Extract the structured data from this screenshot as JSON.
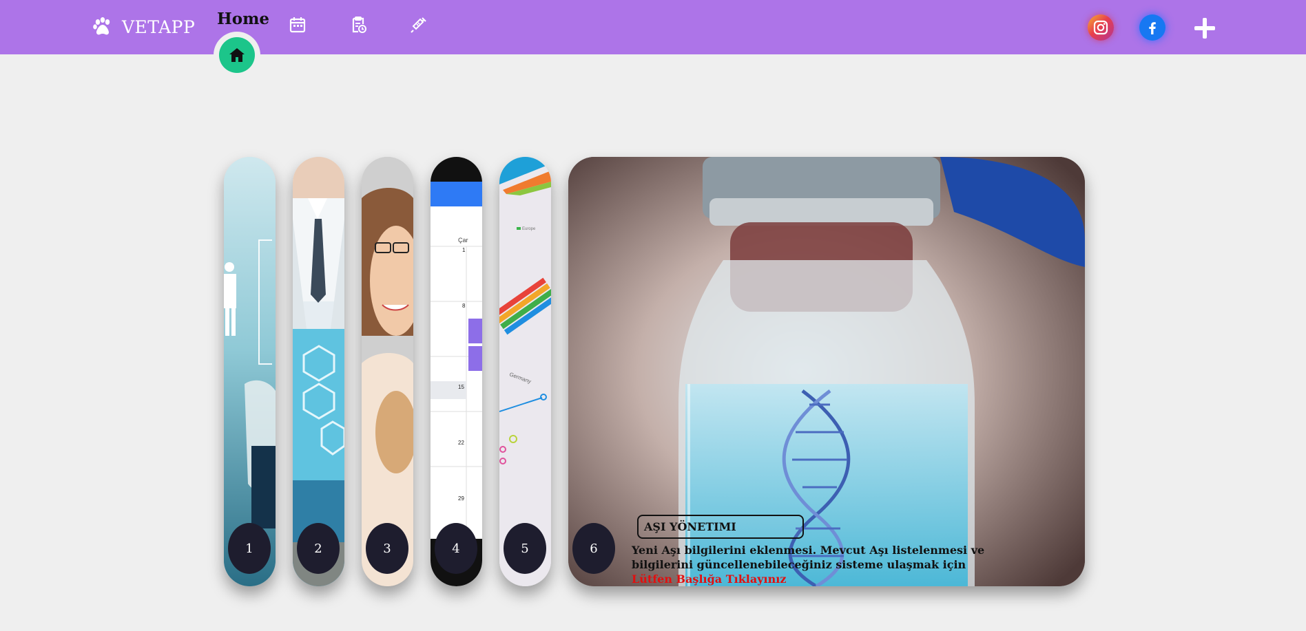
{
  "brand": {
    "name": "VETAPP",
    "icon": "paw-icon"
  },
  "nav": {
    "home_label": "Home",
    "items": [
      {
        "icon": "home-icon",
        "active": true
      },
      {
        "icon": "calendar-icon"
      },
      {
        "icon": "clipboard-clock-icon"
      },
      {
        "icon": "syringe-icon"
      }
    ]
  },
  "social": [
    {
      "icon": "instagram-icon"
    },
    {
      "icon": "facebook-icon"
    },
    {
      "icon": "plus-icon"
    }
  ],
  "calendar_preview": {
    "weekday": "Çar",
    "dates": [
      "1",
      "8",
      "15",
      "22",
      "29"
    ]
  },
  "chart_preview": {
    "label": "Germany",
    "legend": "Europe"
  },
  "cards": [
    {
      "number": "1"
    },
    {
      "number": "2"
    },
    {
      "number": "3"
    },
    {
      "number": "4"
    },
    {
      "number": "5"
    },
    {
      "number": "6",
      "title": "AŞI YÖNETIMI",
      "description": "Yeni Aşı bilgilerini eklenmesi. Mevcut Aşı listelenmesi ve bilgilerini güncellenebileceğiniz sisteme ulaşmak için",
      "cta": "Lütfen Başlığa Tıklayınız"
    }
  ],
  "colors": {
    "navbar": "#ad74e8",
    "home_accent": "#1cc58a",
    "card_number_bg": "#1e1d2e",
    "cta": "#e10f0f"
  }
}
